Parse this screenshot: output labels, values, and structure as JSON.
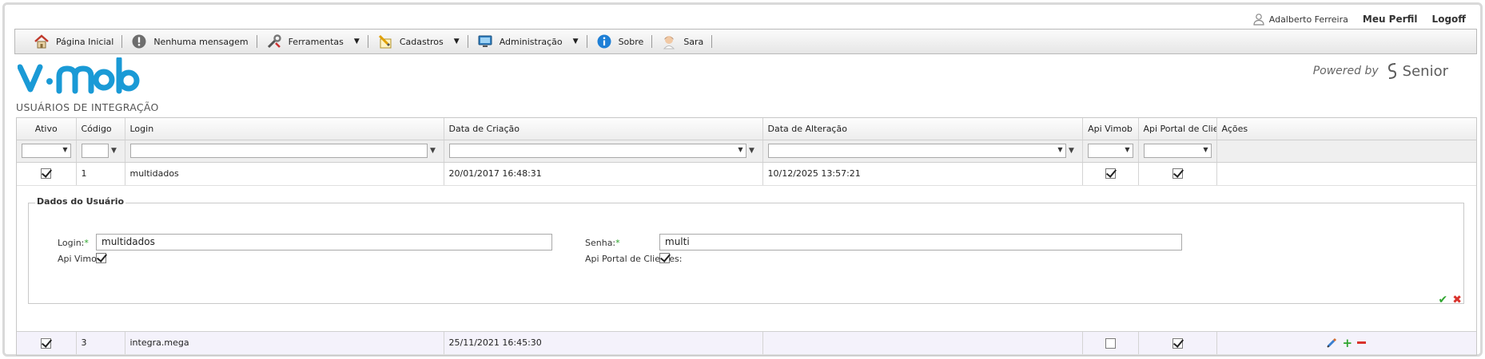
{
  "userbar": {
    "user_name": "Adalberto Ferreira",
    "profile_link": "Meu Perfil",
    "logoff_link": "Logoff"
  },
  "menu": [
    {
      "id": "home",
      "label": "Página Inicial",
      "icon": "house-icon",
      "dropdown": false
    },
    {
      "id": "messages",
      "label": "Nenhuma mensagem",
      "icon": "exclamation-icon",
      "dropdown": false
    },
    {
      "id": "tools",
      "label": "Ferramentas",
      "icon": "wrench-icon",
      "dropdown": true
    },
    {
      "id": "registers",
      "label": "Cadastros",
      "icon": "pencil-paper-icon",
      "dropdown": true
    },
    {
      "id": "admin",
      "label": "Administração",
      "icon": "monitor-icon",
      "dropdown": true
    },
    {
      "id": "about",
      "label": "Sobre",
      "icon": "info-icon",
      "dropdown": false
    },
    {
      "id": "sara",
      "label": "Sara",
      "icon": "assistant-avatar-icon",
      "dropdown": false
    }
  ],
  "brand": {
    "logo_text": "vimob",
    "powered_by": "Powered by",
    "partner": "Senior",
    "accent": "#1a9ad6"
  },
  "page_title": "USUÁRIOS DE INTEGRAÇÃO",
  "grid": {
    "columns": [
      "Ativo",
      "Código",
      "Login",
      "Data de Criação",
      "Data de Alteração",
      "Api Vimob",
      "Api Portal de Clientes",
      "Ações"
    ],
    "rows": [
      {
        "active": true,
        "code": "1",
        "login": "multidados",
        "created": "20/01/2017 16:48:31",
        "updated": "10/12/2025 13:57:21",
        "api_vimob": true,
        "api_portal": true
      },
      {
        "active": true,
        "code": "3",
        "login": "integra.mega",
        "created": "25/11/2021 16:45:30",
        "updated": "",
        "api_vimob": false,
        "api_portal": true
      }
    ]
  },
  "detail": {
    "legend": "Dados do Usuário",
    "login_label": "Login:",
    "login_value": "multidados",
    "password_label": "Senha:",
    "password_value": "multi",
    "api_vimob_label": "Api Vimob:",
    "api_vimob": true,
    "api_portal_label": "Api Portal de Clientes:",
    "api_portal": true,
    "required_mark": "*"
  }
}
